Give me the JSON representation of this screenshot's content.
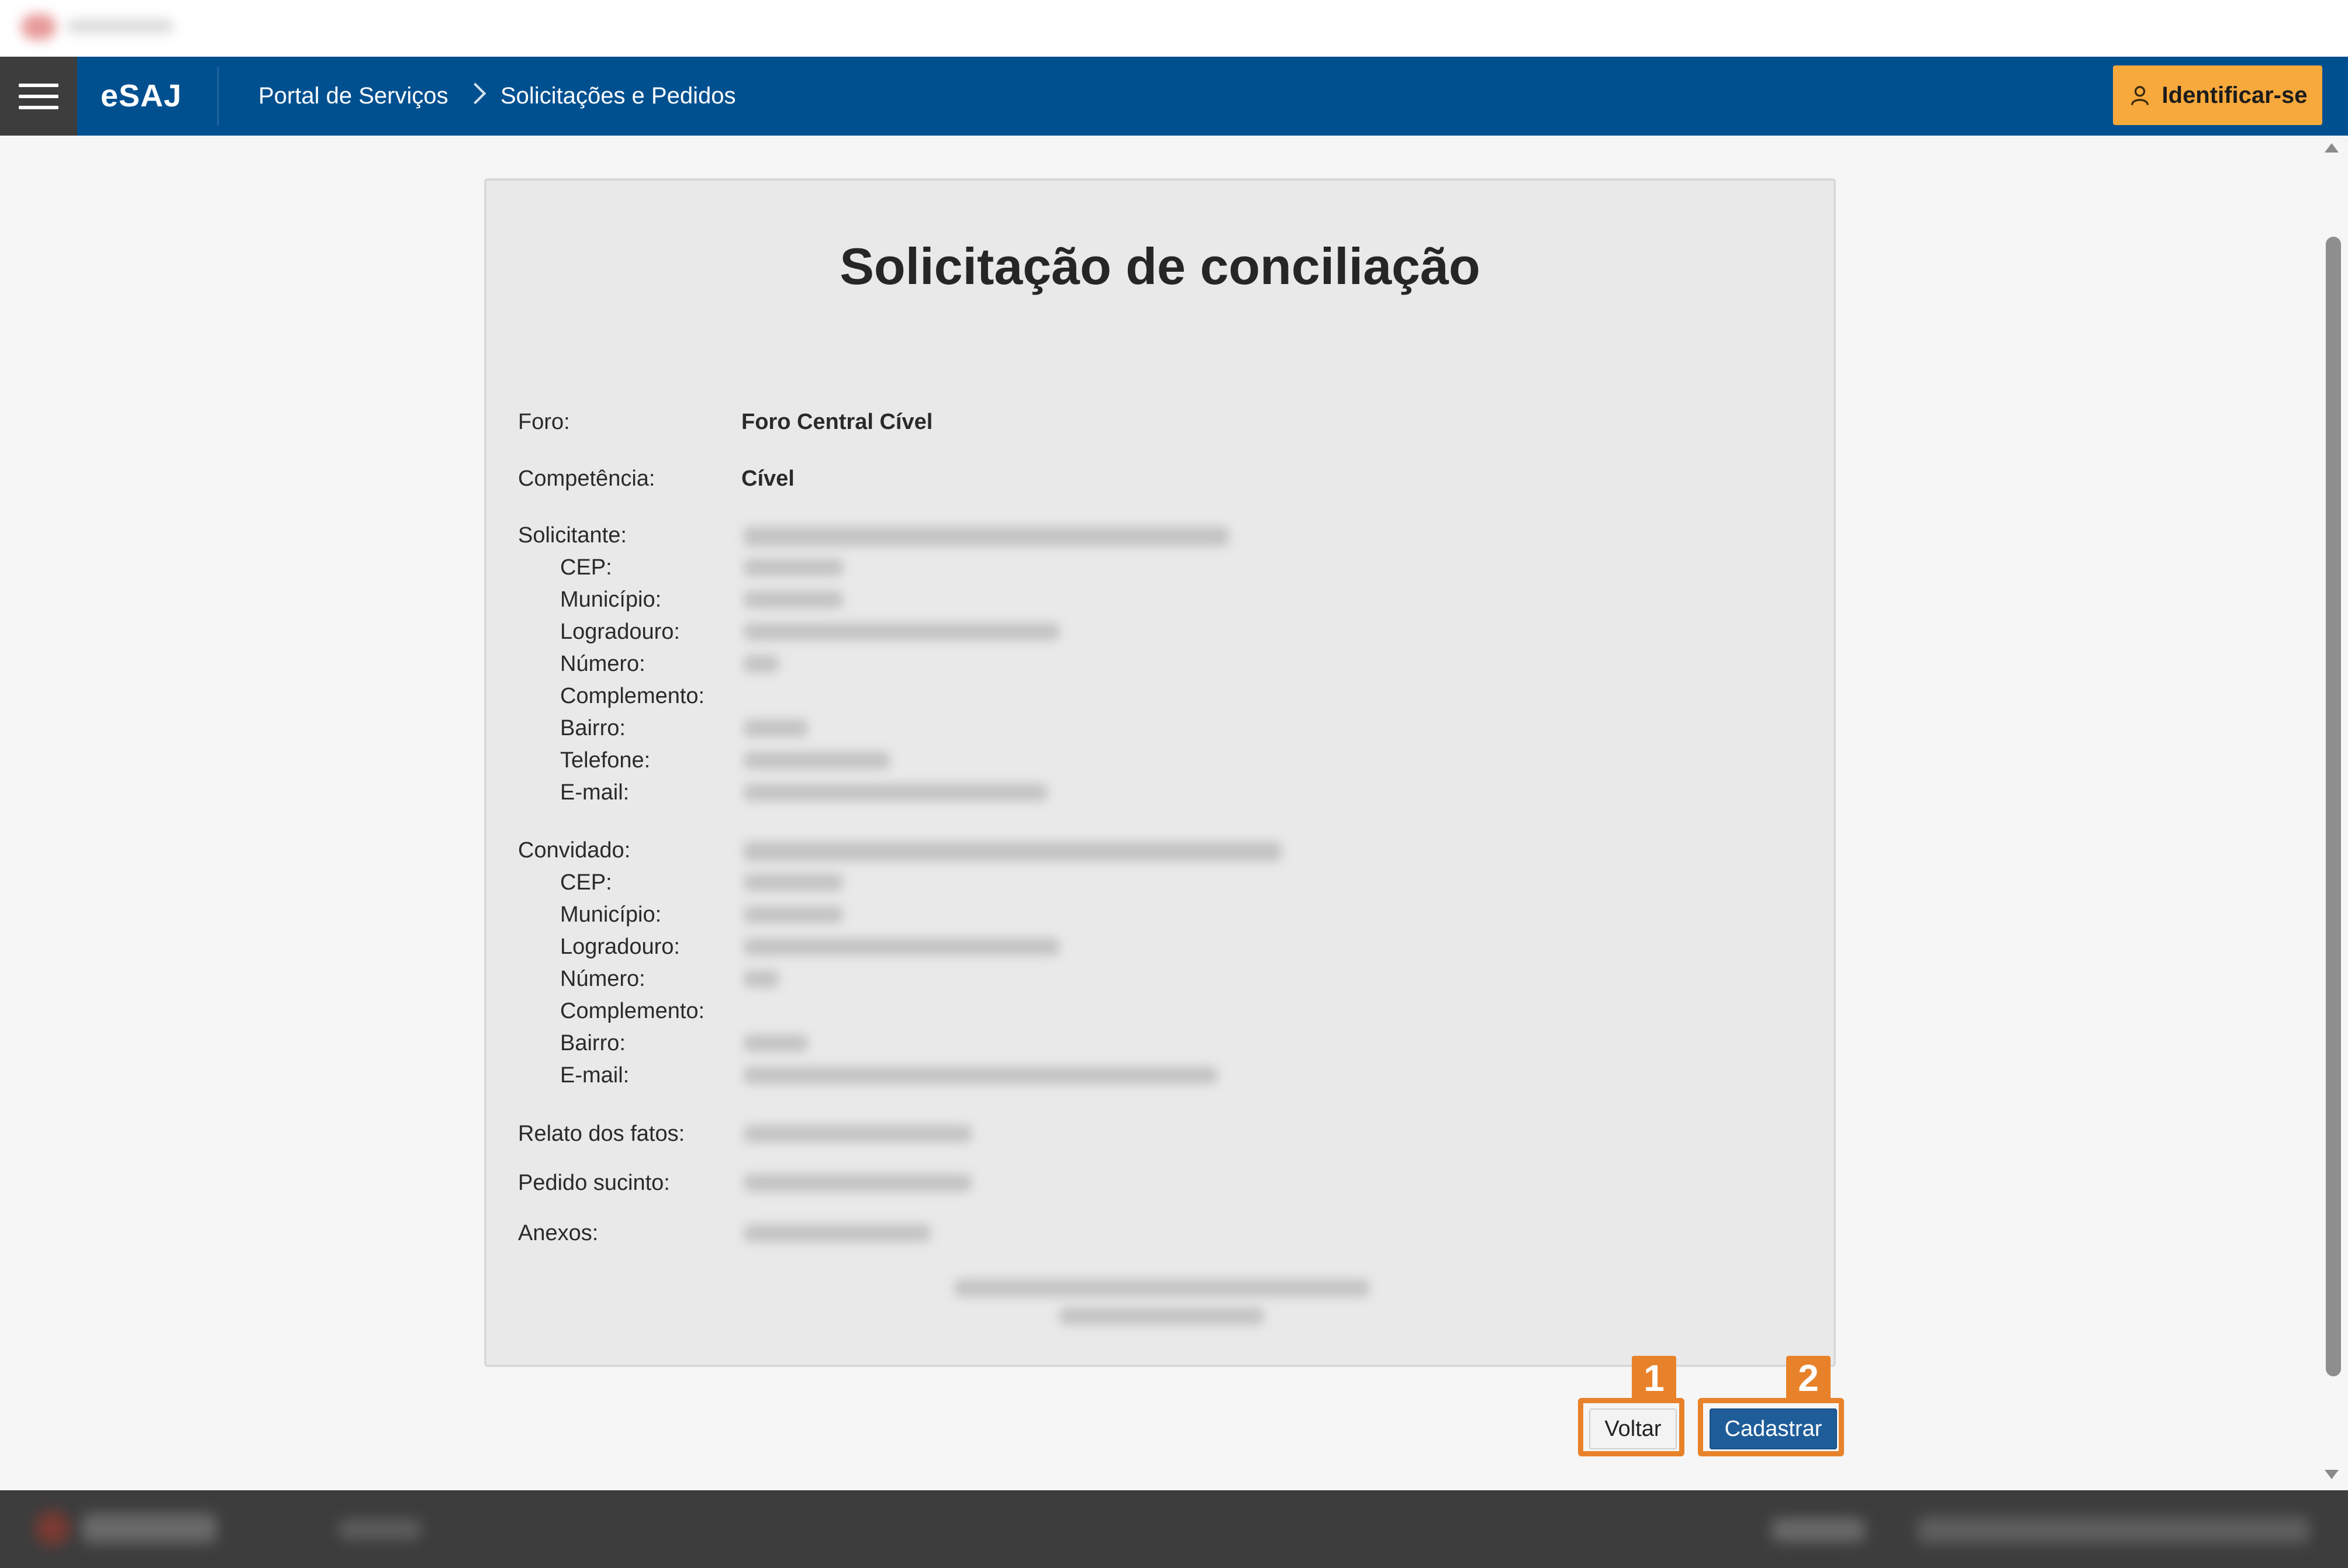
{
  "header": {
    "brand": "eSAJ",
    "breadcrumb": [
      "Portal de Serviços",
      "Solicitações e Pedidos"
    ],
    "login_label": "Identificar-se"
  },
  "card": {
    "title": "Solicitação de conciliação",
    "foro_label": "Foro:",
    "foro_value": "Foro Central Cível",
    "competencia_label": "Competência:",
    "competencia_value": "Cível",
    "solicitante": {
      "label": "Solicitante:",
      "fields": [
        "CEP:",
        "Município:",
        "Logradouro:",
        "Número:",
        "Complemento:",
        "Bairro:",
        "Telefone:",
        "E-mail:"
      ]
    },
    "convidado": {
      "label": "Convidado:",
      "fields": [
        "CEP:",
        "Município:",
        "Logradouro:",
        "Número:",
        "Complemento:",
        "Bairro:",
        "E-mail:"
      ]
    },
    "relato_label": "Relato dos fatos:",
    "pedido_label": "Pedido sucinto:",
    "anexos_label": "Anexos:"
  },
  "actions": {
    "voltar_label": "Voltar",
    "cadastrar_label": "Cadastrar",
    "badge_1": "1",
    "badge_2": "2"
  },
  "colors": {
    "header_bg": "#005090",
    "login_bg": "#f7a93c",
    "highlight": "#e8822a",
    "primary_button": "#1f5d99"
  }
}
